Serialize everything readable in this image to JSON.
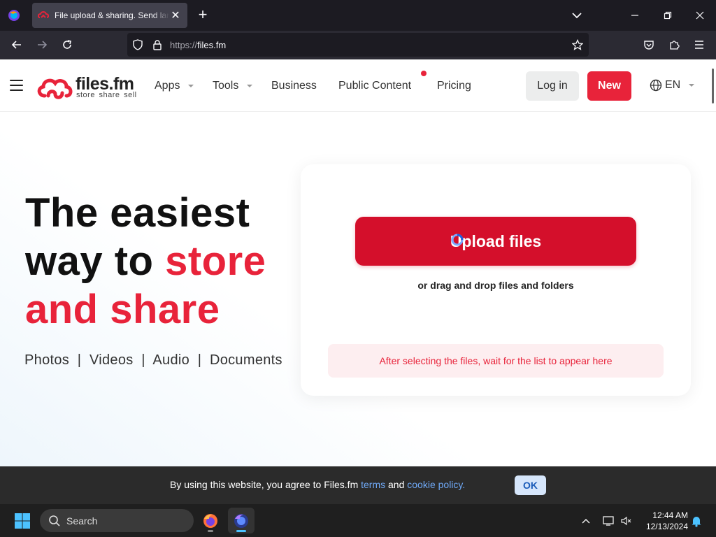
{
  "browser": {
    "tab_title": "File upload & sharing. Send large files",
    "url_scheme": "https://",
    "url_host": "files.fm"
  },
  "header": {
    "logo_name": "files.fm",
    "logo_tagline": "store share sell",
    "menu": [
      "Apps",
      "Tools",
      "Business",
      "Public Content",
      "Pricing"
    ],
    "login_label": "Log in",
    "new_label": "New",
    "language": "EN"
  },
  "hero": {
    "heading_line1": "The easiest",
    "heading_line2_plain": "way to ",
    "heading_line2_accent": "store",
    "heading_line3_accent": "and share",
    "categories": "Photos  |  Videos  |  Audio  |  Documents"
  },
  "upload": {
    "button_label": "Upload files",
    "drag_text": "or drag and drop files and folders",
    "hint_text": "After selecting the files, wait for the list to appear here"
  },
  "cookie": {
    "text_before": "By using this website, you agree to Files.fm ",
    "terms_link": "terms",
    "text_middle": " and ",
    "policy_link": "cookie policy.",
    "ok_label": "OK"
  },
  "taskbar": {
    "search_placeholder": "Search",
    "time": "12:44 AM",
    "date": "12/13/2024"
  },
  "colors": {
    "brand_red": "#e8233a",
    "upload_red": "#d40f2b",
    "link_blue": "#6fa8f5"
  }
}
